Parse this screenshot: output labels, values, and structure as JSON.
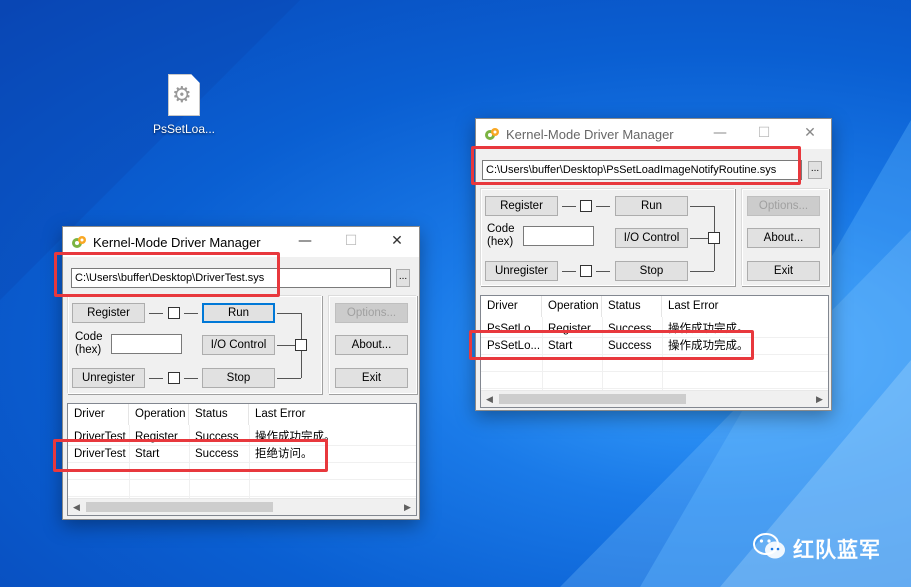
{
  "desktop": {
    "icon_label": "PsSetLoa..."
  },
  "window_left": {
    "title": "Kernel-Mode Driver Manager",
    "path_value": "C:\\Users\\buffer\\Desktop\\DriverTest.sys",
    "browse_label": "...",
    "buttons": {
      "register": "Register",
      "run": "Run",
      "io_control": "I/O Control",
      "unregister": "Unregister",
      "stop": "Stop",
      "options": "Options...",
      "about": "About...",
      "exit": "Exit"
    },
    "code_label": "Code\n(hex)",
    "code_value": "",
    "columns": [
      "Driver",
      "Operation",
      "Status",
      "Last Error"
    ],
    "rows": [
      [
        "DriverTest",
        "Register",
        "Success",
        "操作成功完成。"
      ],
      [
        "DriverTest",
        "Start",
        "Success",
        "拒绝访问。"
      ]
    ]
  },
  "window_right": {
    "title": "Kernel-Mode Driver Manager",
    "path_value": "C:\\Users\\buffer\\Desktop\\PsSetLoadImageNotifyRoutine.sys",
    "browse_label": "...",
    "buttons": {
      "register": "Register",
      "run": "Run",
      "io_control": "I/O Control",
      "unregister": "Unregister",
      "stop": "Stop",
      "options": "Options...",
      "about": "About...",
      "exit": "Exit"
    },
    "code_label": "Code\n(hex)",
    "code_value": "",
    "columns": [
      "Driver",
      "Operation",
      "Status",
      "Last Error"
    ],
    "rows": [
      [
        "PsSetLo...",
        "Register",
        "Success",
        "操作成功完成。"
      ],
      [
        "PsSetLo...",
        "Start",
        "Success",
        "操作成功完成。"
      ]
    ]
  },
  "watermark": {
    "text": "红队蓝军"
  },
  "colors": {
    "desktop": "#0a5fd2",
    "highlight_box": "#e8383d",
    "default_button_border": "#0078d7"
  },
  "icons": [
    "gear-file-icon",
    "driver-app-icon",
    "minimize-icon",
    "maximize-icon",
    "close-icon",
    "wechat-icon"
  ]
}
